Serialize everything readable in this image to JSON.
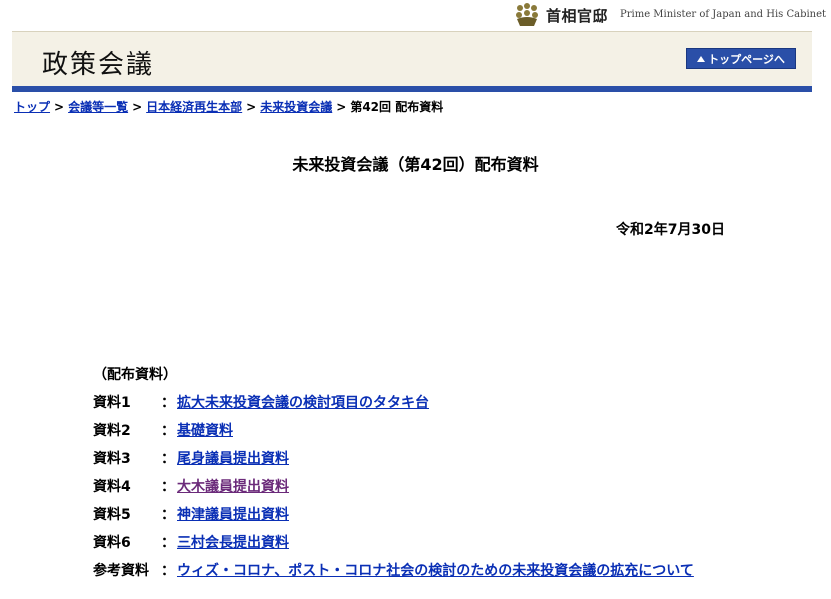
{
  "header": {
    "site_name": "首相官邸",
    "site_name_en": "Prime Minister of Japan and His Cabinet",
    "section_title": "政策会議",
    "top_page_button": "トップページへ"
  },
  "breadcrumb": [
    {
      "label": "トップ"
    },
    {
      "label": "会議等一覧"
    },
    {
      "label": "日本経済再生本部"
    },
    {
      "label": "未来投資会議"
    },
    {
      "label": "第42回 配布資料"
    }
  ],
  "page_title": "未来投資会議（第42回）配布資料",
  "date": "令和2年7月30日",
  "section_label": "（配布資料）",
  "materials": [
    {
      "label": "資料1",
      "title": "拡大未来投資会議の検討項目のタタキ台"
    },
    {
      "label": "資料2",
      "title": "基礎資料"
    },
    {
      "label": "資料3",
      "title": "尾身議員提出資料"
    },
    {
      "label": "資料4",
      "title": "大木議員提出資料"
    },
    {
      "label": "資料5",
      "title": "神津議員提出資料"
    },
    {
      "label": "資料6",
      "title": "三村会長提出資料"
    },
    {
      "label": "参考資料",
      "title": "ウィズ・コロナ、ポスト・コロナ社会の検討のための未来投資会議の拡充について"
    }
  ],
  "colors": {
    "link": "#0a2fb5",
    "visited_link": "#6b2a7a",
    "accent_bar": "#2a4fa8",
    "banner_bg": "#f4f1e6"
  }
}
